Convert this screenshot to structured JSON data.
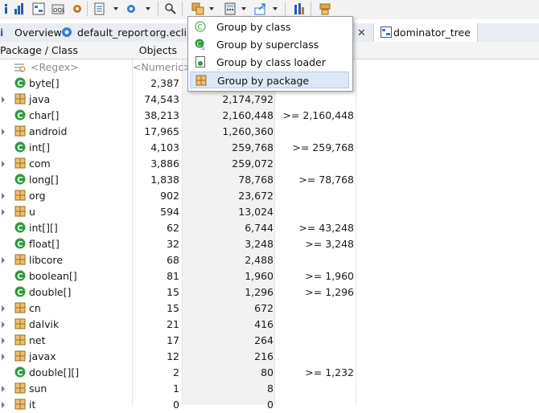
{
  "tabs": [
    {
      "label": "Overview",
      "icon": "info-icon"
    },
    {
      "label": "default_report",
      "icon": "report-icon"
    },
    {
      "label": "org.eclip",
      "icon": ""
    },
    {
      "label": "dominator_tree",
      "icon": "dominator-tree-icon"
    }
  ],
  "columns": {
    "name": "Package / Class",
    "objects": "Objects"
  },
  "filters": {
    "name": "<Regex>",
    "objects": "<Numeric>"
  },
  "menu": {
    "items": [
      {
        "label": "Group by class",
        "icon": "class-icon"
      },
      {
        "label": "Group by superclass",
        "icon": "superclass-icon"
      },
      {
        "label": "Group by class loader",
        "icon": "classloader-icon"
      },
      {
        "label": "Group by package",
        "icon": "package-icon",
        "selected": true
      }
    ]
  },
  "rows": [
    {
      "name": "byte[]",
      "type": "class",
      "objects": "2,387",
      "shallow": "",
      "retained": ""
    },
    {
      "name": "java",
      "type": "package",
      "objects": "74,543",
      "shallow": "2,174,792",
      "retained": ""
    },
    {
      "name": "char[]",
      "type": "class",
      "objects": "38,213",
      "shallow": "2,160,448",
      "retained": ">= 2,160,448"
    },
    {
      "name": "android",
      "type": "package",
      "objects": "17,965",
      "shallow": "1,260,360",
      "retained": ""
    },
    {
      "name": "int[]",
      "type": "class",
      "objects": "4,103",
      "shallow": "259,768",
      "retained": ">= 259,768"
    },
    {
      "name": "com",
      "type": "package",
      "objects": "3,886",
      "shallow": "259,072",
      "retained": ""
    },
    {
      "name": "long[]",
      "type": "class",
      "objects": "1,838",
      "shallow": "78,768",
      "retained": ">= 78,768"
    },
    {
      "name": "org",
      "type": "package",
      "objects": "902",
      "shallow": "23,672",
      "retained": ""
    },
    {
      "name": "u",
      "type": "package",
      "objects": "594",
      "shallow": "13,024",
      "retained": ""
    },
    {
      "name": "int[][]",
      "type": "class",
      "objects": "62",
      "shallow": "6,744",
      "retained": ">= 43,248"
    },
    {
      "name": "float[]",
      "type": "class",
      "objects": "32",
      "shallow": "3,248",
      "retained": ">= 3,248"
    },
    {
      "name": "libcore",
      "type": "package",
      "objects": "68",
      "shallow": "2,488",
      "retained": ""
    },
    {
      "name": "boolean[]",
      "type": "class",
      "objects": "81",
      "shallow": "1,960",
      "retained": ">= 1,960"
    },
    {
      "name": "double[]",
      "type": "class",
      "objects": "15",
      "shallow": "1,296",
      "retained": ">= 1,296"
    },
    {
      "name": "cn",
      "type": "package",
      "objects": "15",
      "shallow": "672",
      "retained": ""
    },
    {
      "name": "dalvik",
      "type": "package",
      "objects": "21",
      "shallow": "416",
      "retained": ""
    },
    {
      "name": "net",
      "type": "package",
      "objects": "17",
      "shallow": "264",
      "retained": ""
    },
    {
      "name": "javax",
      "type": "package",
      "objects": "12",
      "shallow": "216",
      "retained": ""
    },
    {
      "name": "double[][]",
      "type": "class",
      "objects": "2",
      "shallow": "80",
      "retained": ">= 1,232"
    },
    {
      "name": "sun",
      "type": "package",
      "objects": "1",
      "shallow": "8",
      "retained": ""
    },
    {
      "name": "it",
      "type": "package",
      "objects": "0",
      "shallow": "0",
      "retained": ""
    }
  ],
  "colors": {
    "class_icon": "#2e9e3e",
    "package_icon": "#c9893a",
    "selection": "#dde8f6"
  }
}
